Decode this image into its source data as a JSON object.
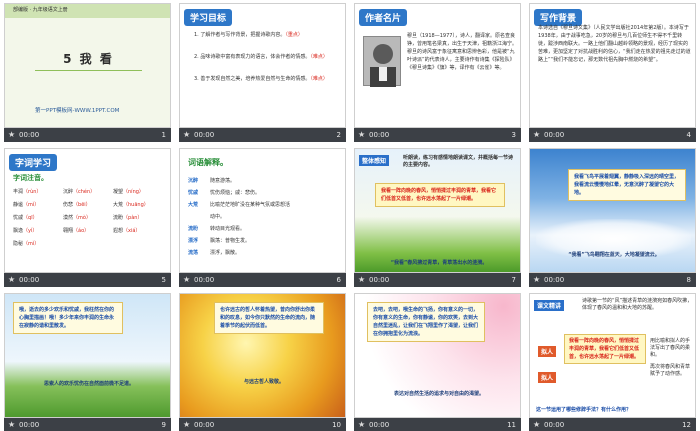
{
  "slides": [
    {
      "num": "1",
      "duration": "00:00",
      "header": "部编版 · 九年级语文上册",
      "title": "5 我 看",
      "footer": "第一PPT模板网-WWW.1PPT.COM"
    },
    {
      "num": "2",
      "duration": "00:00",
      "title": "学习目标",
      "goals": [
        {
          "text": "1. 了解作者与写作背景，把握诗歌内容。",
          "tag": "（重点）"
        },
        {
          "text": "2. 品味诗歌中富有表现力的语言，体会作者的情感。",
          "tag": "（难点）"
        },
        {
          "text": "3. 善于发现自然之美，培养热爱自然与生命的情感。",
          "tag": "（难点）"
        }
      ]
    },
    {
      "num": "3",
      "duration": "00:00",
      "title": "作者名片",
      "body": "穆旦（1918—1977），诗人，翻译家。原名查良铮，曾用笔名梁真，出生于天津，祖籍浙江海宁。穆旦的诗风富于象征寓意和思辨色彩，他是被“九叶诗派”的代表诗人，主要诗作有诗集《探险队》《穆旦诗集》《旗》等，译作有《云雀》等。"
    },
    {
      "num": "4",
      "duration": "00:00",
      "title": "写作背景",
      "body": "本诗选自《穆旦诗文集》（人民文学出版社2014年第2版）。本诗写于1938年，由于战事吃急，20岁的穆旦与几百位师生不得不千里转徙，跋涉西南联大。一路上他们翻山越岭领略的景观，经历了现实的苦难，更加坚定了对抗战胜利的信心，“我们走在热爱的祖先走过的道路上”“我们不能忘记，那无数代祖先胸中燃烧的希望”。"
    },
    {
      "num": "5",
      "duration": "00:00",
      "title": "字词学习",
      "subtitle": "字词注音。",
      "words": [
        {
          "han": "丰润",
          "py": "（rùn）"
        },
        {
          "han": "沉醉",
          "py": "（chén）"
        },
        {
          "han": "凝望",
          "py": "（níng）"
        },
        {
          "han": "静谧",
          "py": "（mì）"
        },
        {
          "han": "伤悲",
          "py": "（bēi）"
        },
        {
          "han": "大荒",
          "py": "（huāng）"
        },
        {
          "han": "忧戚",
          "py": "（qī）"
        },
        {
          "han": "漠然",
          "py": "（mò）"
        },
        {
          "han": "流盼",
          "py": "（pàn）"
        },
        {
          "han": "飘逸",
          "py": "（yì）"
        },
        {
          "han": "翱翔",
          "py": "（áo）"
        },
        {
          "han": "遐想",
          "py": "（xiá）"
        },
        {
          "han": "隐秘",
          "py": "（mì）"
        }
      ]
    },
    {
      "num": "6",
      "duration": "00:00",
      "title": "词语解释。",
      "terms": [
        {
          "word": "沉醉",
          "def": "随意游荡。"
        },
        {
          "word": "忧戚",
          "def": "忧伤烦恼；戚：悲伤。"
        },
        {
          "word": "大荒",
          "def": "比喻茫茫地旷没在某种气氛或思想活"
        },
        {
          "word": "",
          "def": "动中。"
        },
        {
          "word": "流盼",
          "def": "转动目光观看。"
        },
        {
          "word": "漂浮",
          "def": "飘荡：普物生发。"
        },
        {
          "word": "流荡",
          "def": "漂浮，飘散。"
        }
      ]
    },
    {
      "num": "7",
      "duration": "00:00",
      "tag": "整体感知",
      "prompt": "听朗读，练习有感情地朗读课文，并概括每一节诗的主要内容。",
      "poem": "我看一阵向晚的春风，悄悄揉过丰润的青草，我看它们低首又低首，也许远水荡起了一片绿潮。",
      "caption": "“我看”春风拂过青草，青草荡出水的涟漪。"
    },
    {
      "num": "8",
      "duration": "00:00",
      "poem": "我看飞鸟平展着翅翼，静静吸入深远的晴空里，我看流云慢慢地红晕，无意沉醉了凝望它的大地。",
      "caption": "“我看”飞鸟翱翔在蓝天，大地凝望流云。"
    },
    {
      "num": "9",
      "duration": "00:00",
      "poem": "哦，逝去的多少欢乐和忧戚，我枉然在你的心胸里描画！哦！多少年来你丰润的生命永在寂静的谐和里散发。",
      "caption": "思索人的欢乐忧伤在自然面前微不足道。"
    },
    {
      "num": "10",
      "duration": "00:00",
      "poem": "也许远古的哲人怀着热望，曾向你舒出你柔和的叹息，如今你只默然的生命的流向，随着季节的起伏而低首。",
      "caption": "与远古哲人致敬。"
    },
    {
      "num": "11",
      "duration": "00:00",
      "poem": "去吧，去吧，哦生命的飞扬，你有意义的一切，你有意义的生命，你有静谧，你的欢笑，去到大自然里迷乱，让我们在飞翔里作了渴望，让我们在你拥抱里化为流浪。",
      "caption": "表达对自然生活的追求与对自由的渴望。"
    },
    {
      "num": "12",
      "duration": "00:00",
      "tag": "课文精讲",
      "intro": "诗歌第一节的“风”描述青草的涟漪宛如春风吹拂，体现了春风的温和和大地的苏醒。",
      "poem": "我看一阵向晚的春风，悄悄揉过丰润的青草，我看它们低首又低首，也许远水荡起了一片绿潮。",
      "labels": [
        "拟人",
        "拟人"
      ],
      "notes": [
        "用比喻和拟人的手法写出了春风的柔和。",
        "再次将春风和青草赋予了动作感。"
      ],
      "question": "这一节运用了哪些修辞手法？有什么作用？"
    }
  ]
}
